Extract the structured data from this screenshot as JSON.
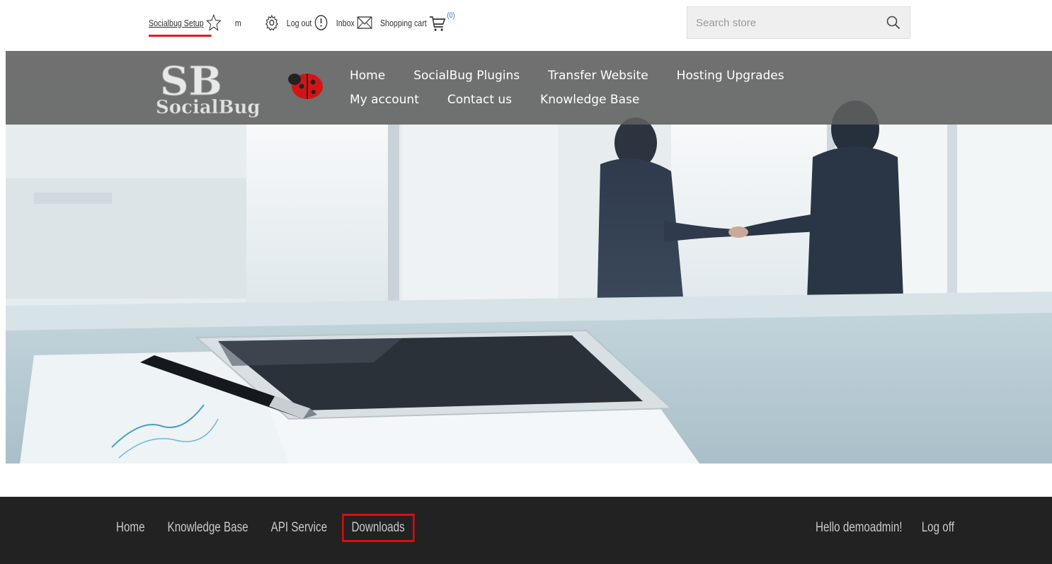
{
  "header": {
    "links": {
      "setup": "Socialbug Setup",
      "user_initial": "m",
      "logout": "Log out",
      "inbox": "Inbox",
      "cart": "Shopping cart",
      "cart_count": "(0)"
    },
    "search": {
      "placeholder": "Search store"
    }
  },
  "main_nav": {
    "row1": [
      "Home",
      "SocialBug Plugins",
      "Transfer Website",
      "Hosting Upgrades"
    ],
    "row2": [
      "My account",
      "Contact us",
      "Knowledge Base"
    ]
  },
  "logo": {
    "text_top": "SB",
    "text_bottom": "SocialBug"
  },
  "footer_nav": {
    "items": [
      "Home",
      "Knowledge Base",
      "API Service",
      "Downloads"
    ],
    "highlighted": "Downloads",
    "greeting": "Hello demoadmin!",
    "logoff": "Log off"
  },
  "colors": {
    "accent_red": "#e30b0b",
    "cart_count_blue": "#2a6db5",
    "footer_bg": "#222222",
    "nav_band": "#5f5f5f"
  },
  "icons": {
    "setup": "star-icon",
    "settings": "gear-icon",
    "logout": "power-icon",
    "inbox": "envelope-icon",
    "cart": "cart-icon",
    "search": "search-icon"
  }
}
